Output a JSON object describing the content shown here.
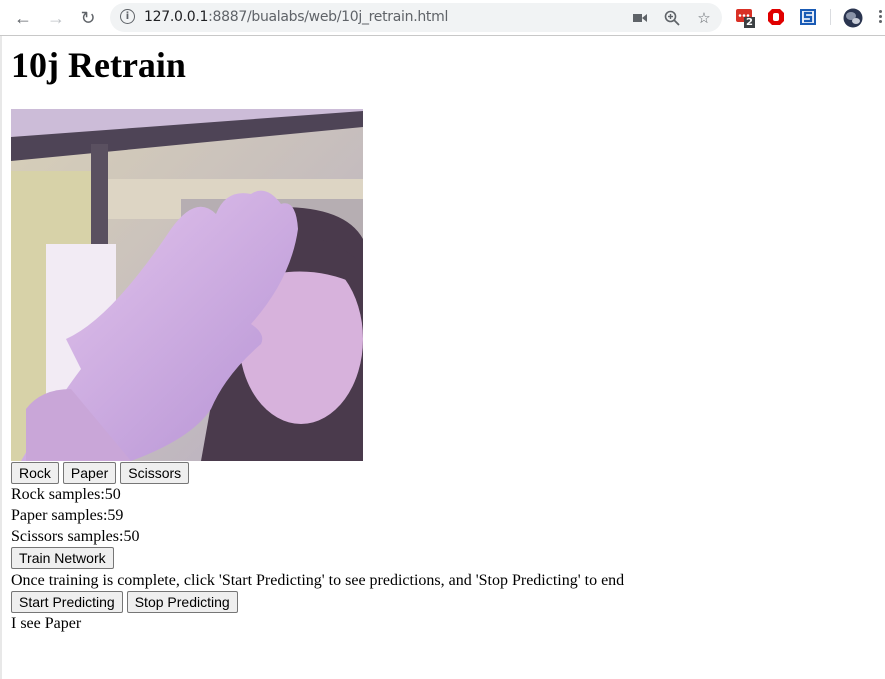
{
  "browser": {
    "url_host": "127.0.0.1",
    "url_rest": ":8887/bualabs/web/10j_retrain.html",
    "extension_badge": "2",
    "icons": [
      "back-icon",
      "forward-icon",
      "reload-icon",
      "info-icon",
      "camera-icon",
      "zoom-icon",
      "star-icon",
      "extension-red-icon",
      "extension-stop-icon",
      "extension-s-icon",
      "profile-avatar"
    ]
  },
  "page": {
    "title": "10j Retrain",
    "webcam_alt": "Webcam feed: person holding up open palm",
    "buttons": {
      "rock": "Rock",
      "paper": "Paper",
      "scissors": "Scissors",
      "train": "Train Network",
      "start": "Start Predicting",
      "stop": "Stop Predicting"
    },
    "samples": {
      "rock": "Rock samples:50",
      "paper": "Paper samples:59",
      "scissors": "Scissors samples:50"
    },
    "instructions": "Once training is complete, click 'Start Predicting' to see predictions, and 'Stop Predicting' to end",
    "prediction": "I see Paper"
  }
}
